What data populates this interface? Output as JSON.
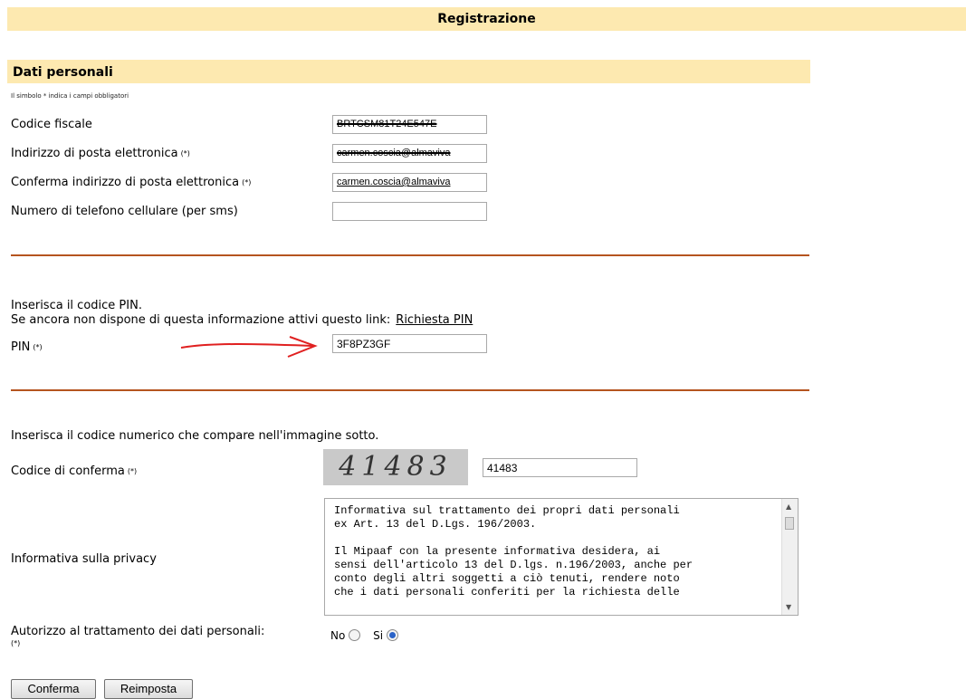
{
  "page": {
    "title": "Registrazione"
  },
  "personal": {
    "section_title": "Dati personali",
    "required_note": "Il simbolo * indica i campi obbligatori",
    "required_mark": "(*)",
    "codice_fiscale": {
      "label": "Codice fiscale",
      "value": "BRTCSM81T24E547E"
    },
    "email": {
      "label": "Indirizzo di posta elettronica",
      "value": "carmen.coscia@almaviva"
    },
    "email_confirm": {
      "label": "Conferma indirizzo di posta elettronica",
      "value": "carmen.coscia@almaviva"
    },
    "phone": {
      "label": "Numero di telefono cellulare (per sms)",
      "value": ""
    }
  },
  "pin": {
    "instruction": "Inserisca il codice PIN.",
    "link_prompt": "Se ancora non dispone di questa informazione attivi questo link:",
    "link_label": "Richiesta PIN",
    "label": "PIN",
    "value": "3F8PZ3GF"
  },
  "captcha": {
    "instruction": "Inserisca il codice numerico che compare nell'immagine sotto.",
    "label": "Codice di conferma",
    "image_text": "41483",
    "value": "41483"
  },
  "privacy": {
    "label": "Informativa sulla privacy",
    "text": "Informativa sul trattamento dei propri dati personali\nex Art. 13 del D.Lgs. 196/2003.\n\nIl Mipaaf con la presente informativa desidera, ai\nsensi dell'articolo 13 del D.lgs. n.196/2003, anche per\nconto degli altri soggetti a ciò tenuti, rendere noto\nche i dati personali conferiti per la richiesta delle"
  },
  "consent": {
    "label": "Autorizzo al trattamento dei dati personali:",
    "options": [
      {
        "label": "No",
        "selected": false
      },
      {
        "label": "Si",
        "selected": true
      }
    ]
  },
  "buttons": {
    "confirm": "Conferma",
    "reset": "Reimposta"
  },
  "colors": {
    "accent_bar": "#fde9b0",
    "separator": "#b5541f",
    "annotation_arrow": "#e02020"
  }
}
